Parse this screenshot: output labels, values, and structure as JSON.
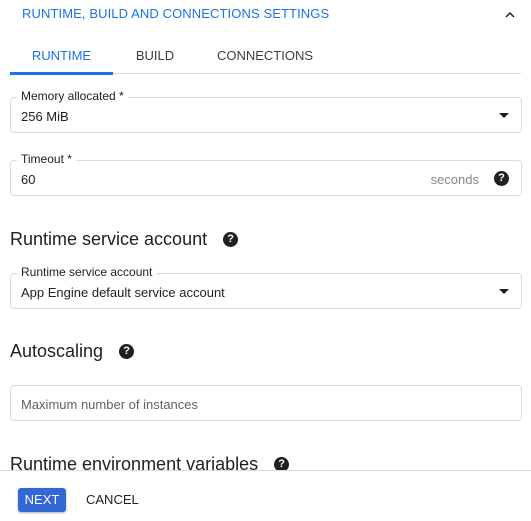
{
  "section": {
    "title": "RUNTIME, BUILD AND CONNECTIONS SETTINGS",
    "collapse_icon": "chevron-up-icon"
  },
  "tabs": [
    {
      "label": "RUNTIME",
      "active": true
    },
    {
      "label": "BUILD",
      "active": false
    },
    {
      "label": "CONNECTIONS",
      "active": false
    }
  ],
  "memory": {
    "label": "Memory allocated *",
    "value": "256 MiB"
  },
  "timeout": {
    "label": "Timeout *",
    "value": "60",
    "suffix": "seconds",
    "help_icon": "help-icon"
  },
  "service_account": {
    "heading": "Runtime service account",
    "label": "Runtime service account",
    "value": "App Engine default service account"
  },
  "autoscaling": {
    "heading": "Autoscaling",
    "max_instances_placeholder": "Maximum number of instances"
  },
  "env_vars": {
    "heading": "Runtime environment variables"
  },
  "help_glyph": "?",
  "footer": {
    "next_label": "NEXT",
    "cancel_label": "CANCEL"
  },
  "colors": {
    "accent": "#1a73e8",
    "primary_button": "#3367d6"
  }
}
